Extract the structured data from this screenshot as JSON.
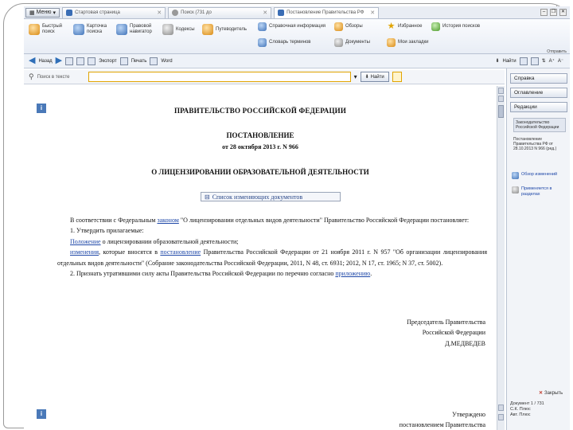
{
  "tabbar": {
    "menu_label": "Меню",
    "tabs": [
      {
        "label": "Стартовая страница"
      },
      {
        "label": "Поиск (731 до"
      },
      {
        "label": "Постановление Правительства РФ"
      }
    ]
  },
  "toolbar": {
    "items": [
      {
        "label": "Быстрый поиск",
        "icon": "search-icon"
      },
      {
        "label": "Карточка поиска",
        "icon": "card-icon"
      },
      {
        "label": "Правовой навигатор",
        "icon": "navigator-icon"
      },
      {
        "label": "Кодексы",
        "icon": "book-icon"
      },
      {
        "label": "Путеводитель",
        "icon": "guide-icon"
      },
      {
        "label": "Справочная информация",
        "icon": "info-icon"
      },
      {
        "label": "Обзоры",
        "icon": "review-icon"
      },
      {
        "label": "Избранное",
        "icon": "star-icon"
      },
      {
        "label": "История поисков",
        "icon": "history-icon"
      },
      {
        "label": "Словарь терминов",
        "icon": "dictionary-icon"
      },
      {
        "label": "Документы",
        "icon": "documents-icon"
      },
      {
        "label": "Мои закладки",
        "icon": "bookmark-icon"
      }
    ],
    "right_label": "Отправить"
  },
  "navbar": {
    "back_label": "Назад",
    "print_label": "Печать",
    "word_label": "Word",
    "export_label": "Экспорт",
    "found_label": "Найти"
  },
  "search": {
    "label": "Поиск в тексте",
    "placeholder": "",
    "find_label": "Найти"
  },
  "document": {
    "gov": "ПРАВИТЕЛЬСТВО РОССИЙСКОЙ ФЕДЕРАЦИИ",
    "type": "ПОСТАНОВЛЕНИЕ",
    "date": "от 28 октября 2013 г. N 966",
    "title": "О ЛИЦЕНЗИРОВАНИИ ОБРАЗОВАТЕЛЬНОЙ ДЕЯТЕЛЬНОСТИ",
    "changes_label": "Список изменяющих документов",
    "p1_a": "В соответствии с Федеральным ",
    "p1_link": "законом",
    "p1_b": " \"О лицензировании отдельных видов деятельности\" Правительство Российской Федерации постановляет:",
    "p2": "1. Утвердить прилагаемые:",
    "p3_link": "Положение",
    "p3_b": " о лицензировании образовательной деятельности;",
    "p4_link": "изменения",
    "p4_b": ", которые вносятся в ",
    "p4_link2": "постановление",
    "p4_c": " Правительства Российской Федерации от 21 ноября 2011 г. N 957 \"Об организации лицензирования отдельных видов деятельности\" (Собрание законодательства Российской Федерации, 2011, N 48, ст. 6931; 2012, N 17, ст. 1965; N 37, ст. 5002).",
    "p5_a": "2. Признать утратившими силу акты Правительства Российской Федерации по перечню согласно ",
    "p5_link": "приложению",
    "p5_b": ".",
    "sign1": "Председатель Правительства",
    "sign2": "Российской Федерации",
    "sign3": "Д.МЕДВЕДЕВ",
    "approved1": "Утверждено",
    "approved2": "постановлением Правительства"
  },
  "rpanel": {
    "btn1": "Справка",
    "btn2": "Оглавление",
    "btn3": "Редакции",
    "note1": "Законодательство Российской Федерации",
    "note2": "Постановление Правительства РФ от 28.10.2013 N 966 (ред.)",
    "link1": "Обзор изменений",
    "link2": "Применяется в разделах",
    "close_label": "Закрыть",
    "footer1": "Документ 1 / 731",
    "footer2": "С.К. Плюс",
    "footer3": "Авт. Плюс"
  }
}
